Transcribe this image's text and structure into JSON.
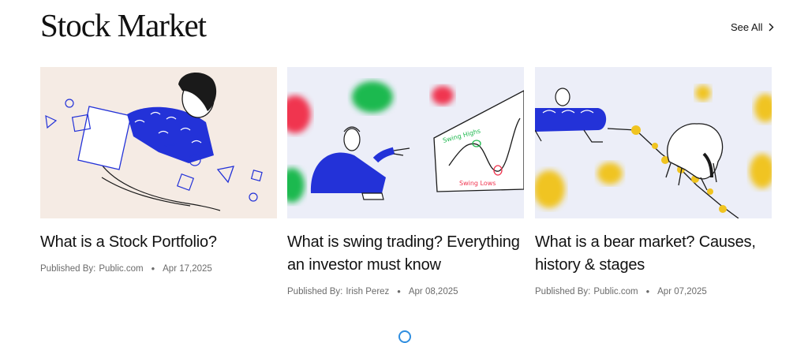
{
  "section": {
    "title": "Stock Market",
    "see_all": "See All"
  },
  "articles": [
    {
      "title": "What is a Stock Portfolio?",
      "published_label": "Published By:",
      "author": "Public.com",
      "date": "Apr 17,2025",
      "illustration": "person-with-geometric-shapes"
    },
    {
      "title": "What is swing trading? Everything an investor must know",
      "published_label": "Published By:",
      "author": "Irish Perez",
      "date": "Apr 08,2025",
      "illustration": "person-pointing-at-chart",
      "chart_labels": {
        "high": "Swing Highs",
        "low": "Swing Lows"
      }
    },
    {
      "title": "What is a bear market? Causes, history & stages",
      "published_label": "Published By:",
      "author": "Public.com",
      "date": "Apr 07,2025",
      "illustration": "bear-and-person-with-coins"
    }
  ],
  "colors": {
    "card1_bg": "#f5ebe4",
    "card2_bg": "#eceef8",
    "card3_bg": "#eceef8",
    "accent_blue": "#2332d8",
    "green": "#1fb94f",
    "red": "#f0344f",
    "gold": "#f0c420"
  },
  "icons": {
    "see_all": "chevron-right-icon",
    "meta_separator": "bullet-dot"
  }
}
